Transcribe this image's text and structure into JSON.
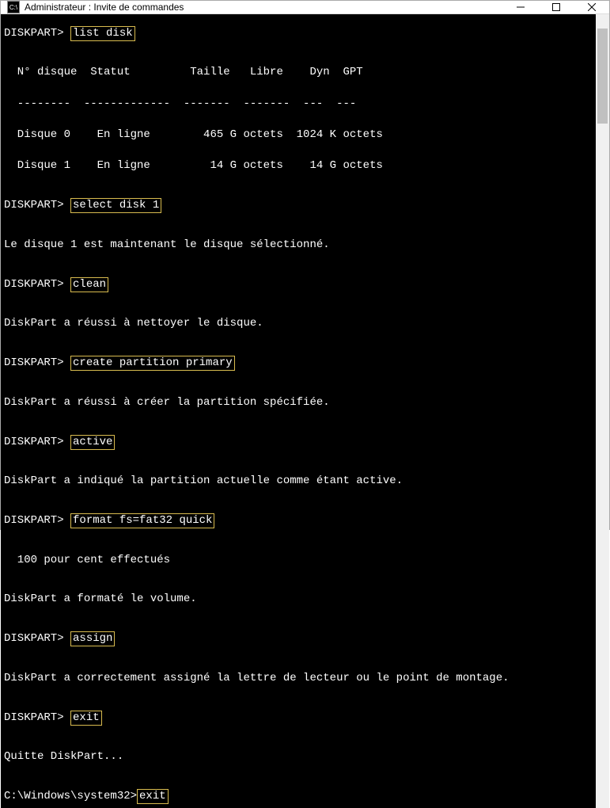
{
  "window": {
    "title": "Administrateur : Invite de commandes",
    "icon_label": "C:\\"
  },
  "terminal": {
    "prompt_dp": "DISKPART> ",
    "prompt_sys": "C:\\Windows\\system32>",
    "cmd_list": "list disk",
    "table_hdr": "  N° disque  Statut         Taille   Libre    Dyn  GPT",
    "table_sep": "  --------  -------------  -------  -------  ---  ---",
    "table_row0": "  Disque 0    En ligne        465 G octets  1024 K octets",
    "table_row1": "  Disque 1    En ligne         14 G octets    14 G octets",
    "cmd_select": "select disk 1",
    "msg_select": "Le disque 1 est maintenant le disque sélectionné.",
    "cmd_clean": "clean",
    "msg_clean": "DiskPart a réussi à nettoyer le disque.",
    "cmd_create": "create partition primary",
    "msg_create": "DiskPart a réussi à créer la partition spécifiée.",
    "cmd_active": "active",
    "msg_active": "DiskPart a indiqué la partition actuelle comme étant active.",
    "cmd_format": "format fs=fat32 quick",
    "msg_format1": "  100 pour cent effectués",
    "msg_format2": "DiskPart a formaté le volume.",
    "cmd_assign": "assign",
    "msg_assign": "DiskPart a correctement assigné la lettre de lecteur ou le point de montage.",
    "cmd_exit": "exit",
    "msg_exit": "Quitte DiskPart...",
    "cmd_exit2": "exit"
  }
}
